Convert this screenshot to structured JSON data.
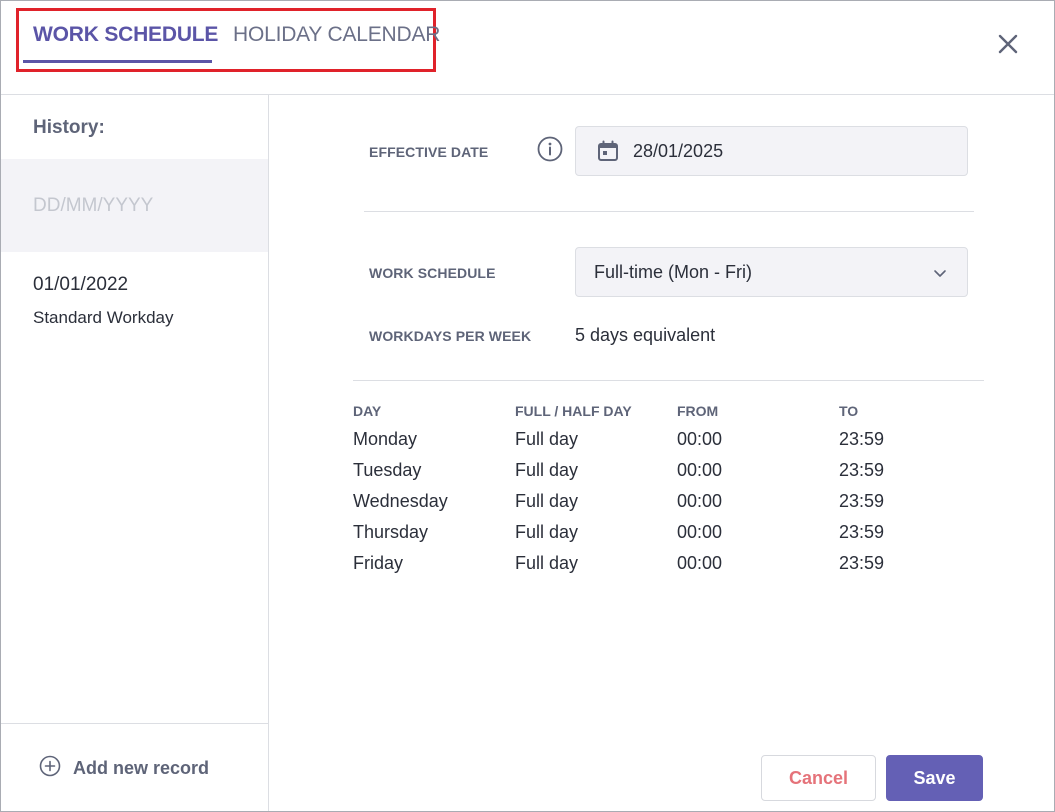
{
  "tabs": [
    {
      "label": "WORK SCHEDULE",
      "active": true
    },
    {
      "label": "HOLIDAY CALENDAR",
      "active": false
    }
  ],
  "close_icon": "close-x-icon",
  "sidebar": {
    "title": "History:",
    "draft_placeholder": "DD/MM/YYYY",
    "items": [
      {
        "date": "01/01/2022",
        "name": "Standard Workday"
      }
    ],
    "add_label": "Add new record"
  },
  "form": {
    "effective_date_label": "EFFECTIVE DATE",
    "effective_date_value": "28/01/2025",
    "work_schedule_label": "WORK SCHEDULE",
    "work_schedule_value": "Full-time (Mon - Fri)",
    "workdays_label": "WORKDAYS PER WEEK",
    "workdays_value": "5 days equivalent"
  },
  "schedule": {
    "headers": [
      "DAY",
      "FULL / HALF DAY",
      "FROM",
      "TO"
    ],
    "rows": [
      [
        "Monday",
        "Full day",
        "00:00",
        "23:59"
      ],
      [
        "Tuesday",
        "Full day",
        "00:00",
        "23:59"
      ],
      [
        "Wednesday",
        "Full day",
        "00:00",
        "23:59"
      ],
      [
        "Thursday",
        "Full day",
        "00:00",
        "23:59"
      ],
      [
        "Friday",
        "Full day",
        "00:00",
        "23:59"
      ]
    ]
  },
  "actions": {
    "cancel_label": "Cancel",
    "save_label": "Save"
  },
  "colors": {
    "accent": "#5b55a7",
    "save_button": "#6460b5",
    "cancel_text": "#e5737a",
    "highlight_box": "#e0222a"
  }
}
